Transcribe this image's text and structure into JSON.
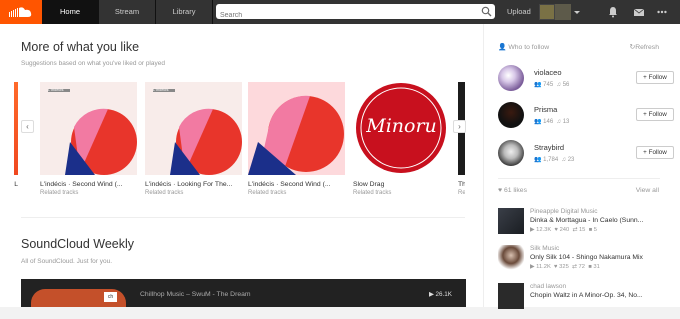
{
  "topbar": {
    "tabs": [
      {
        "label": "Home",
        "active": true
      },
      {
        "label": "Stream",
        "active": false
      },
      {
        "label": "Library",
        "active": false
      }
    ],
    "search_placeholder": "Search",
    "upload_label": "Upload",
    "icons": [
      "soundcloud-logo",
      "search-icon",
      "bell-icon",
      "mail-icon",
      "more-icon"
    ],
    "colors": {
      "brand": "#ff5500",
      "bar": "#333333"
    }
  },
  "more_like": {
    "title": "More of what you like",
    "subtitle": "Suggestions based on what you've liked or played",
    "tiles": [
      {
        "title": "L'indécis · Second Wind (...",
        "sub": "Related tracks",
        "art_label": "L'indécis"
      },
      {
        "title": "L'indécis · Looking For The...",
        "sub": "Related tracks",
        "art_label": "L'indécis"
      },
      {
        "title": "L'indécis · Second Wind (...",
        "sub": "Related tracks"
      },
      {
        "title": "Slow Drag",
        "sub": "Related tracks",
        "art_label": "Minoru"
      },
      {
        "title": "Th",
        "sub": "Re"
      }
    ],
    "partial_left_tile": {
      "title": "L",
      "sub": ""
    }
  },
  "weekly": {
    "title": "SoundCloud Weekly",
    "subtitle": "All of SoundCloud. Just for you.",
    "player_title": "Chillhop Music – SwuM - The Dream",
    "player_count": "26.1K"
  },
  "who_to_follow": {
    "header": "Who to follow",
    "refresh": "Refresh",
    "follow_label": "Follow",
    "users": [
      {
        "name": "violaceo",
        "followers": "745",
        "tracks": "56"
      },
      {
        "name": "Prisma",
        "followers": "146",
        "tracks": "13"
      },
      {
        "name": "Straybird",
        "followers": "1,784",
        "tracks": "23"
      }
    ]
  },
  "likes": {
    "header": "61 likes",
    "view_all": "View all",
    "items": [
      {
        "artist": "Pineapple Digital Music",
        "title": "Dinka & Morttagua - In Caelo (Sunn...",
        "plays": "12.3K",
        "likes": "240",
        "reposts": "15",
        "comments": "5"
      },
      {
        "artist": "Silk Music",
        "title": "Only Silk 104 - Shingo Nakamura Mix",
        "plays": "11.2K",
        "likes": "325",
        "reposts": "72",
        "comments": "31"
      },
      {
        "artist": "chad lawson",
        "title": "Chopin Waltz in A Minor-Op. 34, No...",
        "plays": "",
        "likes": "",
        "reposts": "",
        "comments": ""
      }
    ]
  }
}
